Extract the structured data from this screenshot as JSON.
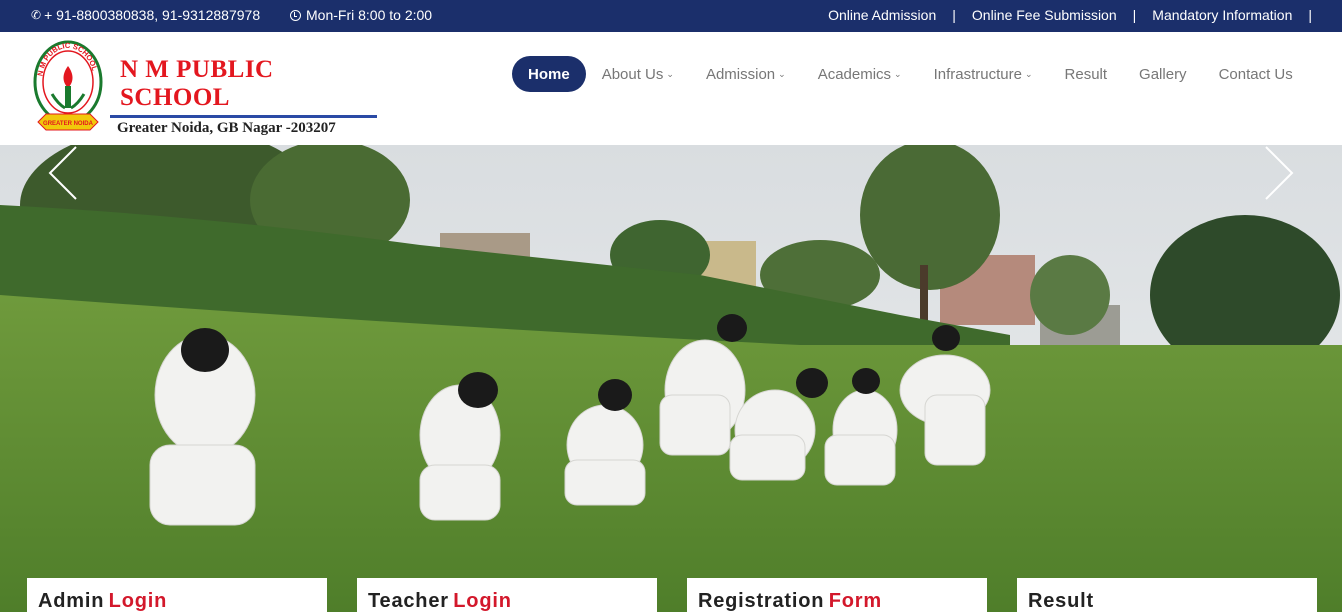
{
  "topbar": {
    "phone_icon": "phone-icon",
    "phones": "+ 91-8800380838, 91-9312887978",
    "clock_icon": "clock-icon",
    "hours": "Mon-Fri 8:00 to 2:00",
    "links": [
      {
        "label": "Online Admission"
      },
      {
        "label": "Online Fee Submission"
      },
      {
        "label": "Mandatory Information"
      }
    ],
    "separator": "|"
  },
  "logo": {
    "emblem_text": "N M PUBLIC SCHOOL",
    "ribbon_text": "GREATER NOIDA",
    "name": "N M PUBLIC SCHOOL",
    "address": "Greater Noida, GB Nagar -203207"
  },
  "nav": {
    "items": [
      {
        "label": "Home",
        "active": true
      },
      {
        "label": "About Us",
        "dropdown": true
      },
      {
        "label": "Admission",
        "dropdown": true
      },
      {
        "label": "Academics",
        "dropdown": true
      },
      {
        "label": "Infrastructure",
        "dropdown": true
      },
      {
        "label": "Result"
      },
      {
        "label": "Gallery"
      },
      {
        "label": "Contact Us"
      }
    ],
    "caret": "⌵"
  },
  "hero": {
    "prev_icon": "chevron-left-icon",
    "next_icon": "chevron-right-icon"
  },
  "cards": [
    {
      "title": "Admin",
      "highlight": "Login"
    },
    {
      "title": "Teacher",
      "highlight": "Login"
    },
    {
      "title": "Registration",
      "highlight": "Form"
    },
    {
      "title": "Result",
      "highlight": ""
    }
  ],
  "colors": {
    "navy": "#1b2f6b",
    "brand_red": "#e3171f",
    "card_accent": "#d3182b"
  }
}
